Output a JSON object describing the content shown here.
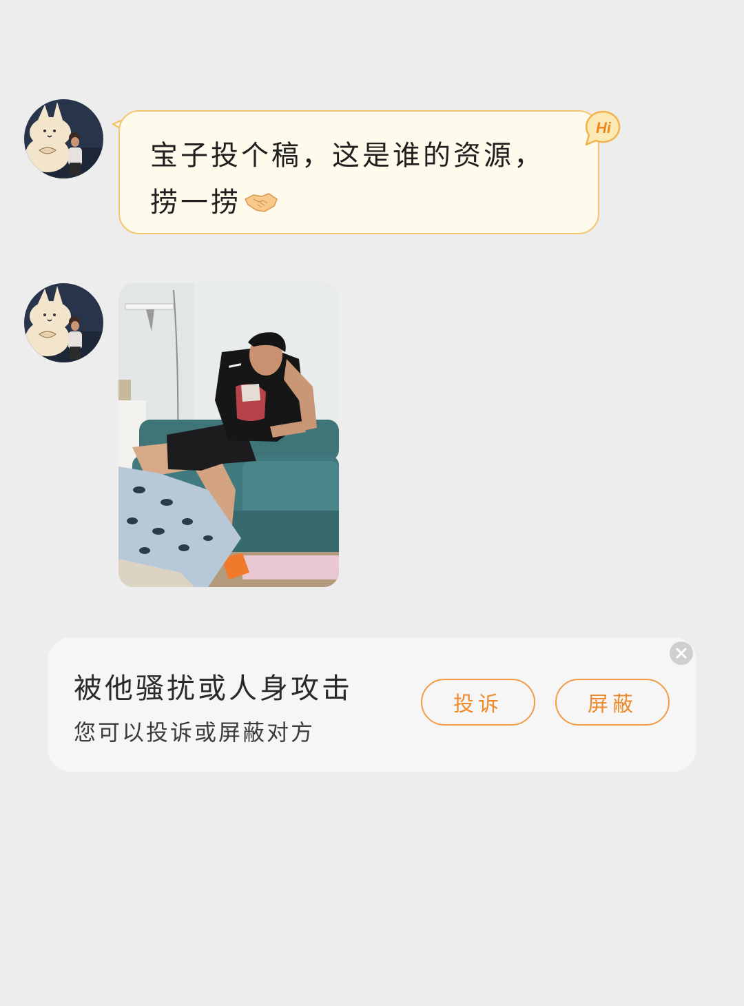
{
  "messages": [
    {
      "type": "text",
      "text": "宝子投个稿，这是谁的资源，捞一捞",
      "emoji": "handshake-emoji",
      "badge": "Hi"
    },
    {
      "type": "image",
      "image": "photo of a young man in black t-shirt sitting on a teal sofa"
    }
  ],
  "report_card": {
    "title": "被他骚扰或人身攻击",
    "subtitle": "您可以投诉或屏蔽对方",
    "complain_label": "投诉",
    "block_label": "屏蔽",
    "close_icon": "close-icon"
  },
  "colors": {
    "background": "#ededed",
    "bubble_fill": "#fffbec",
    "bubble_border": "#f5c470",
    "accent_orange": "#ef8a2c",
    "card_background": "#f6f6f6"
  }
}
